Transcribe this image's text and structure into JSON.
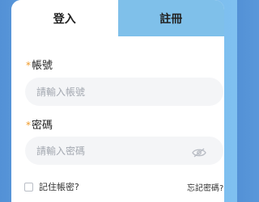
{
  "tabs": [
    {
      "label": "登入",
      "active": true
    },
    {
      "label": "註冊",
      "active": false
    }
  ],
  "account": {
    "required_mark": "*",
    "label": "帳號",
    "placeholder": "請輸入帳號",
    "value": ""
  },
  "password": {
    "required_mark": "*",
    "label": "密碼",
    "placeholder": "請輸入密碼",
    "value": "",
    "toggle_icon": "eye-off-icon"
  },
  "remember": {
    "label": "記住帳密?",
    "checked": false
  },
  "forgot_label": "忘記密碼?",
  "colors": {
    "background": "#5b9ddf",
    "inactive_tab": "#7fc0ea",
    "required": "#f09a2a",
    "input_bg": "#f4f5f7"
  }
}
